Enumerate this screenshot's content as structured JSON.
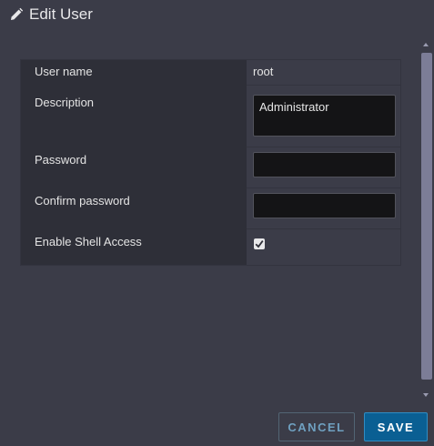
{
  "dialog": {
    "title": "Edit User",
    "title_icon": "pencil-icon"
  },
  "form": {
    "username_label": "User name",
    "username_value": "root",
    "description_label": "Description",
    "description_value": "Administrator",
    "password_label": "Password",
    "password_value": "",
    "confirm_password_label": "Confirm password",
    "confirm_password_value": "",
    "shell_access_label": "Enable Shell Access",
    "shell_access_checked": true
  },
  "buttons": {
    "cancel_label": "CANCEL",
    "save_label": "SAVE"
  },
  "colors": {
    "background": "#3b3c48",
    "label_column": "#2e2f38",
    "primary_button": "#0a5f93",
    "secondary_text": "#6fa0c0"
  }
}
